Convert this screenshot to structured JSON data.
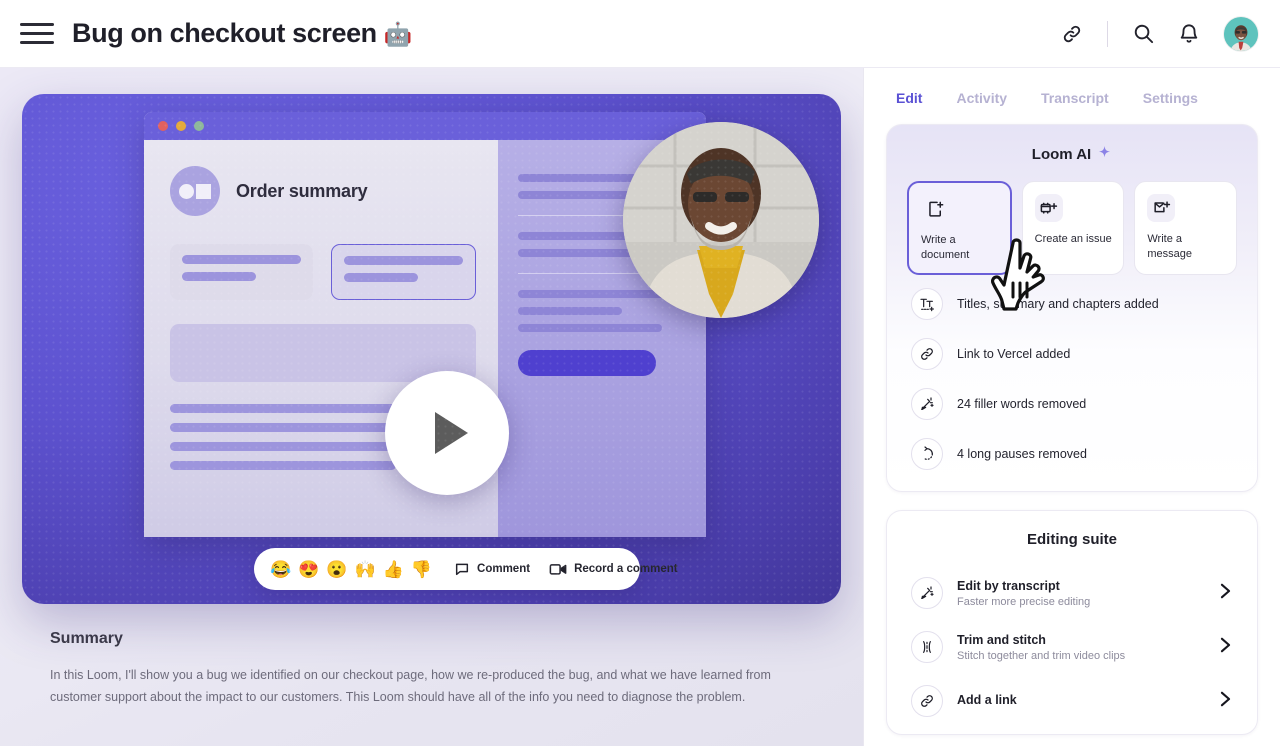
{
  "topbar": {
    "menu_icon": "hamburger-menu-icon",
    "title": "Bug on checkout screen",
    "title_emoji": "🤖",
    "icons": [
      {
        "name": "link-icon",
        "label": "Copy link"
      },
      {
        "name": "search-icon",
        "label": "Search"
      },
      {
        "name": "bell-icon",
        "label": "Notifications"
      }
    ],
    "avatar_alt": "User avatar"
  },
  "video": {
    "chrome_dots": [
      "red",
      "yellow",
      "green"
    ],
    "mock_title": "Order summary",
    "play_button": "play-button",
    "reactions": [
      "😂",
      "😍",
      "😮",
      "🙌",
      "👍",
      "👎"
    ],
    "comment_label": "Comment",
    "record_label": "Record a comment"
  },
  "summary": {
    "heading": "Summary",
    "body": "In this Loom, I'll show you a bug we identified on our checkout page, how we re-produced the bug, and what we have learned from customer support about the impact to our customers. This Loom should have all of the info you need to diagnose the problem."
  },
  "sidebar": {
    "tabs": [
      {
        "label": "Edit",
        "active": true
      },
      {
        "label": "Activity",
        "active": false
      },
      {
        "label": "Transcript",
        "active": false
      },
      {
        "label": "Settings",
        "active": false
      }
    ],
    "ai_panel": {
      "title": "Loom AI",
      "sparkle_icon": "sparkle-icon",
      "cards": [
        {
          "label": "Write a document",
          "icon": "document-plus-icon",
          "selected": true
        },
        {
          "label": "Create an issue",
          "icon": "issue-plus-icon",
          "selected": false
        },
        {
          "label": "Write a message",
          "icon": "message-plus-icon",
          "selected": false
        }
      ],
      "items": [
        {
          "label": "Titles, summary and chapters added",
          "icon": "text-format-icon"
        },
        {
          "label": "Link to Vercel added",
          "icon": "link-icon"
        },
        {
          "label": "24 filler words removed",
          "icon": "magic-wand-icon"
        },
        {
          "label": "4 long pauses removed",
          "icon": "refresh-icon"
        }
      ]
    },
    "editing_suite": {
      "title": "Editing suite",
      "items": [
        {
          "title": "Edit by transcript",
          "subtitle": "Faster more precise editing",
          "icon": "magic-wand-icon"
        },
        {
          "title": "Trim and stitch",
          "subtitle": "Stitch together and trim video clips",
          "icon": "trim-icon"
        },
        {
          "title": "Add a link",
          "subtitle": "",
          "icon": "link-plus-icon"
        }
      ]
    }
  },
  "colors": {
    "accent_purple": "#5a51d4",
    "selected_border": "#6a5fd8",
    "video_purple": "#5d52cf",
    "tab_inactive": "#b6b2d2"
  }
}
